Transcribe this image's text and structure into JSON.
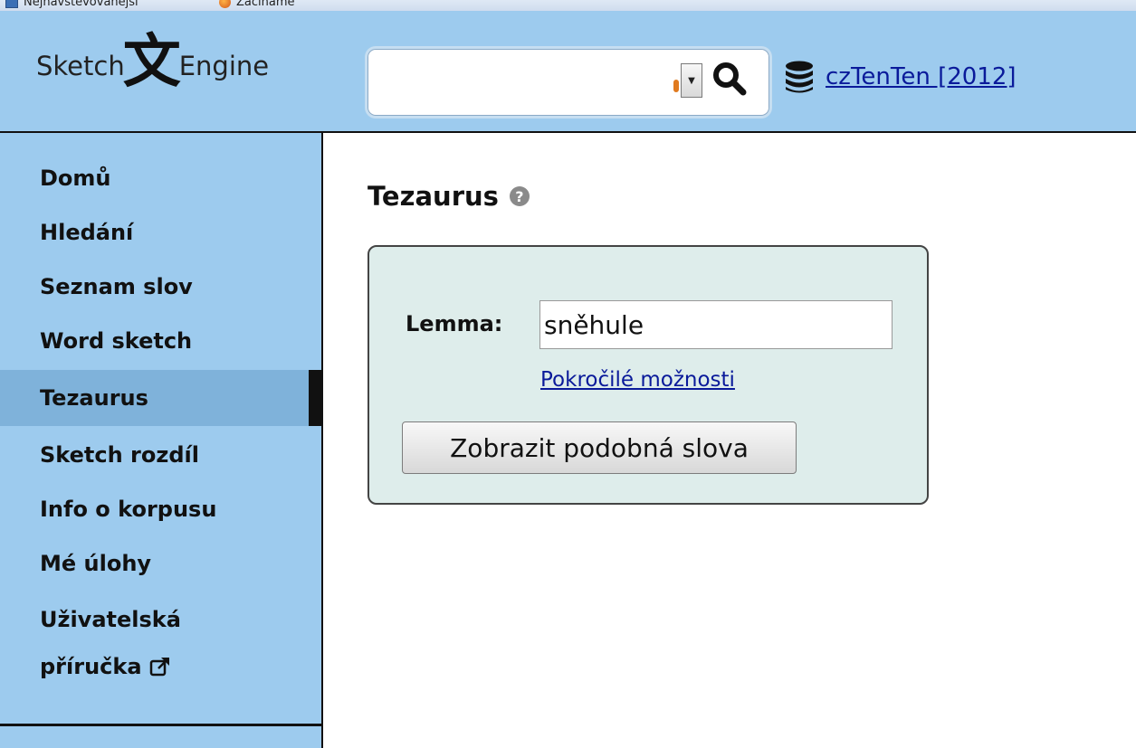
{
  "bookmarks": {
    "items": [
      {
        "label": "Nejnavštěvovanější",
        "icon": "page-icon"
      },
      {
        "label": "Začínáme",
        "icon": "firefox-icon"
      }
    ]
  },
  "header": {
    "logo": {
      "left": "Sketch",
      "glyph": "文",
      "right": "Engine"
    },
    "search": {
      "value": "",
      "placeholder": ""
    },
    "search_icon": "search-icon",
    "dropdown_icon": "chevron-down-icon",
    "corpus": {
      "icon": "database-icon",
      "label": "czTenTen [2012]"
    }
  },
  "sidebar": {
    "items": [
      {
        "label": "Domů"
      },
      {
        "label": "Hledání"
      },
      {
        "label": "Seznam slov"
      },
      {
        "label": "Word sketch"
      },
      {
        "label": "Tezaurus",
        "active": true
      },
      {
        "label": "Sketch rozdíl"
      },
      {
        "label": "Info o korpusu"
      },
      {
        "label": "Mé úlohy"
      },
      {
        "label_line1": "Uživatelská",
        "label_line2": "příručka",
        "icon": "external-link-icon"
      }
    ]
  },
  "main": {
    "title": "Tezaurus",
    "help_icon": "help-icon",
    "help_glyph": "?",
    "form": {
      "lemma_label": "Lemma:",
      "lemma_value": "sněhule",
      "advanced_link": "Pokročilé možnosti",
      "submit_label": "Zobrazit podobná slova"
    }
  },
  "colors": {
    "header_bg": "#9dcbee",
    "sidebar_active": "#7fb2da",
    "panel_bg": "#deedeb",
    "link": "#0a1a9a"
  }
}
